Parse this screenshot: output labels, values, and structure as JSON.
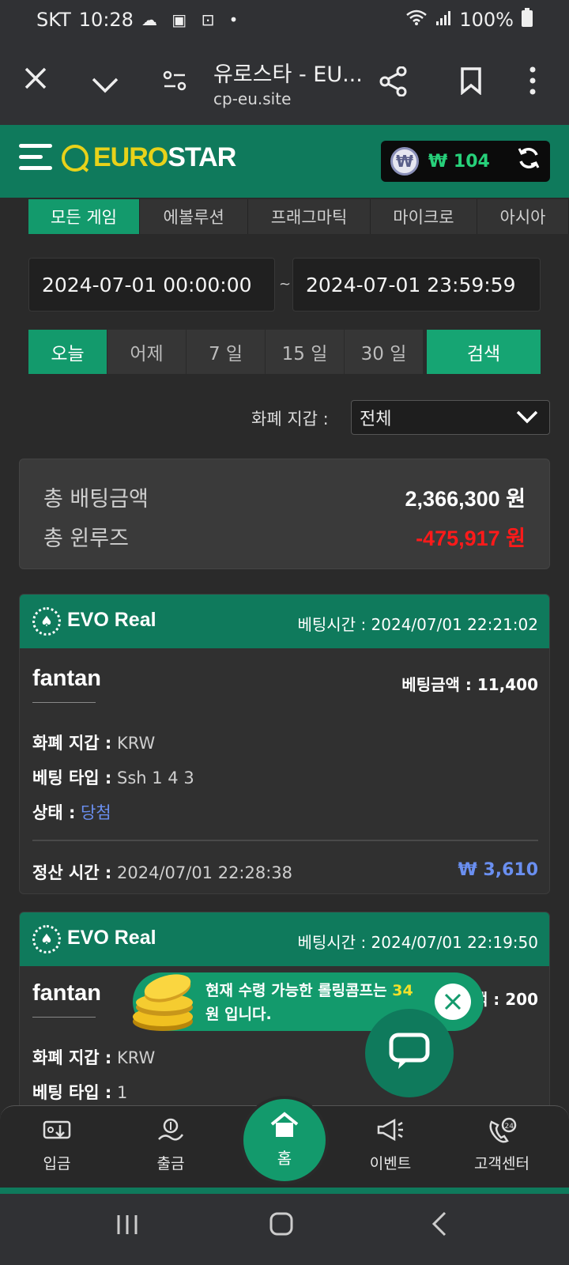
{
  "status": {
    "carrier": "SKT",
    "time": "10:28",
    "icons": "☁ ▣ ⊡ •",
    "battery": "100%"
  },
  "browser": {
    "title": "유로스타 - EU...",
    "url": "cp-eu.site"
  },
  "header": {
    "logo_euro": "EURO",
    "logo_star": "STAR",
    "balance": "₩ 104"
  },
  "tabs": [
    "모든 게임",
    "에볼루션",
    "프래그마틱",
    "마이크로",
    "아시아"
  ],
  "filters": {
    "date_from": "2024-07-01 00:00:00",
    "date_sep": "~",
    "date_to": "2024-07-01 23:59:59",
    "quick": [
      "오늘",
      "어제",
      "7 일",
      "15 일",
      "30 일"
    ],
    "search": "검색",
    "currency_label": "화폐 지갑 :",
    "currency_value": "전체"
  },
  "summary": {
    "bet_label": "총 배팅금액",
    "bet_value": "2,366,300 원",
    "winloss_label": "총 윈루즈",
    "winloss_value": "-475,917 원"
  },
  "bets": [
    {
      "provider": "EVO Real",
      "bet_time": "베팅시간 : 2024/07/01 22:21:02",
      "game": "fantan",
      "bet_amount": "베팅금액 : 11,400",
      "currency_label": "화폐 지갑 :",
      "currency": "KRW",
      "type_label": "베팅 타입 :",
      "type": "Ssh 1 4 3",
      "status_label": "상태 :",
      "status": "당첨",
      "settle_label": "정산 시간 :",
      "settle_time": "2024/07/01 22:28:38",
      "payout": "₩ 3,610"
    },
    {
      "provider": "EVO Real",
      "bet_time": "베팅시간 : 2024/07/01 22:19:50",
      "game": "fantan",
      "bet_amount": "액 : 200",
      "currency_label": "화폐 지갑 :",
      "currency": "KRW",
      "type_label": "베팅 타입 :",
      "type": "1"
    }
  ],
  "toast": {
    "text_a": "현재 수령 가능한 롤링콤프는 ",
    "amount": "34",
    "text_b": "원 입니다."
  },
  "nav": {
    "deposit": "입금",
    "withdraw": "출금",
    "home": "홈",
    "event": "이벤트",
    "support": "고객센터"
  },
  "colors": {
    "brand_green": "#0f7a5c",
    "accent_green": "#139a6c",
    "loss_red": "#ff1a1a",
    "win_blue": "#6a8ff0",
    "balance_green": "#27d07a"
  }
}
